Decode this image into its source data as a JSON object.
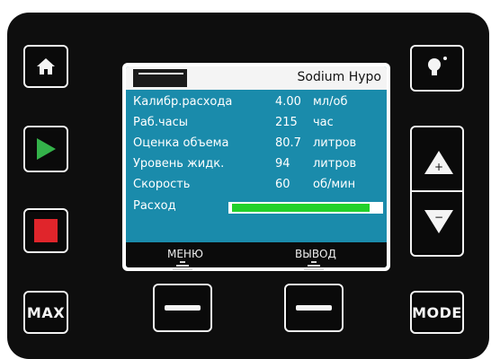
{
  "controls": {
    "home_icon": "home-icon",
    "play_icon": "play-icon",
    "stop_icon": "stop-icon",
    "max_label": "MAX",
    "light_icon": "lightbulb-icon",
    "up_label": "+",
    "down_label": "−",
    "mode_label": "MODE"
  },
  "screen": {
    "title": "Sodium Hypo",
    "rows": [
      {
        "label": "Калибр.расхода",
        "value": "4.00",
        "unit": "мл/об"
      },
      {
        "label": "Раб.часы",
        "value": "215",
        "unit": "час"
      },
      {
        "label": "Оценка объема",
        "value": "80.7",
        "unit": "литров"
      },
      {
        "label": "Уровень жидк.",
        "value": "94",
        "unit": "литров"
      },
      {
        "label": "Скорость",
        "value": "60",
        "unit": "об/мин"
      }
    ],
    "progress_label": "Расход",
    "progress_fraction": 0.93,
    "soft_left": "МЕНЮ",
    "soft_right": "ВЫВОД"
  },
  "colors": {
    "screen_bg": "#1a8bab",
    "play": "#34b24a",
    "stop": "#e0252b",
    "progress": "#23d12b"
  }
}
